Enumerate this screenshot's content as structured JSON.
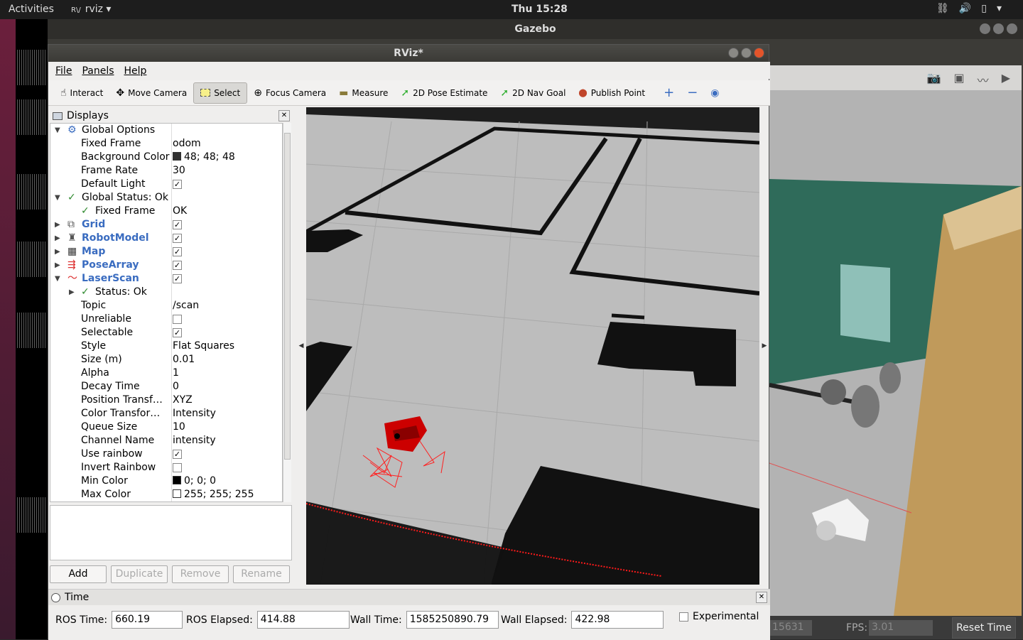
{
  "topbar": {
    "activities": "Activities",
    "app": "rviz ▾",
    "app_icon": "R\\/",
    "clock": "Thu 15:28"
  },
  "gazebo": {
    "title": "Gazebo",
    "sim_time_partial": "15631",
    "fps_label": "FPS:",
    "fps_value": "3.01",
    "reset_label": "Reset Time"
  },
  "rviz": {
    "title": "RViz*",
    "menu": {
      "file": "File",
      "panels": "Panels",
      "help": "Help"
    },
    "toolbar": [
      {
        "label": "Interact",
        "icon": "☝"
      },
      {
        "label": "Move Camera",
        "icon": "✥"
      },
      {
        "label": "Select",
        "icon": "▭"
      },
      {
        "label": "Focus Camera",
        "icon": "⊕"
      },
      {
        "label": "Measure",
        "icon": "▬"
      },
      {
        "label": "2D Pose Estimate",
        "icon": "➚"
      },
      {
        "label": "2D Nav Goal",
        "icon": "➚"
      },
      {
        "label": "Publish Point",
        "icon": "⬤"
      }
    ],
    "displays_title": "Displays",
    "tree": [
      {
        "name": "Global Options",
        "value": ""
      },
      {
        "name": "Fixed Frame",
        "value": "odom"
      },
      {
        "name": "Background Color",
        "value": "48; 48; 48"
      },
      {
        "name": "Frame Rate",
        "value": "30"
      },
      {
        "name": "Default Light",
        "value": "✓"
      },
      {
        "name": "Global Status: Ok",
        "value": ""
      },
      {
        "name": "Fixed Frame",
        "value": "OK"
      },
      {
        "name": "Grid",
        "value": "✓"
      },
      {
        "name": "RobotModel",
        "value": "✓"
      },
      {
        "name": "Map",
        "value": "✓"
      },
      {
        "name": "PoseArray",
        "value": "✓"
      },
      {
        "name": "LaserScan",
        "value": "✓"
      },
      {
        "name": "Status: Ok",
        "value": ""
      },
      {
        "name": "Topic",
        "value": "/scan"
      },
      {
        "name": "Unreliable",
        "value": ""
      },
      {
        "name": "Selectable",
        "value": "✓"
      },
      {
        "name": "Style",
        "value": "Flat Squares"
      },
      {
        "name": "Size (m)",
        "value": "0.01"
      },
      {
        "name": "Alpha",
        "value": "1"
      },
      {
        "name": "Decay Time",
        "value": "0"
      },
      {
        "name": "Position Transf…",
        "value": "XYZ"
      },
      {
        "name": "Color Transfor…",
        "value": "Intensity"
      },
      {
        "name": "Queue Size",
        "value": "10"
      },
      {
        "name": "Channel Name",
        "value": "intensity"
      },
      {
        "name": "Use rainbow",
        "value": "✓"
      },
      {
        "name": "Invert Rainbow",
        "value": ""
      },
      {
        "name": "Min Color",
        "value": "0; 0; 0"
      },
      {
        "name": "Max Color",
        "value": "255; 255; 255"
      }
    ],
    "buttons": {
      "add": "Add",
      "duplicate": "Duplicate",
      "remove": "Remove",
      "rename": "Rename"
    },
    "time": {
      "title": "Time",
      "ros_time_label": "ROS Time:",
      "ros_time": "660.19",
      "ros_elapsed_label": "ROS Elapsed:",
      "ros_elapsed": "414.88",
      "wall_time_label": "Wall Time:",
      "wall_time": "1585250890.79",
      "wall_elapsed_label": "Wall Elapsed:",
      "wall_elapsed": "422.98",
      "experimental_label": "Experimental"
    },
    "colors": {
      "background_swatch": "#303030",
      "min_swatch": "#000000",
      "max_swatch": "#ffffff",
      "laser": "#ff0000"
    }
  }
}
